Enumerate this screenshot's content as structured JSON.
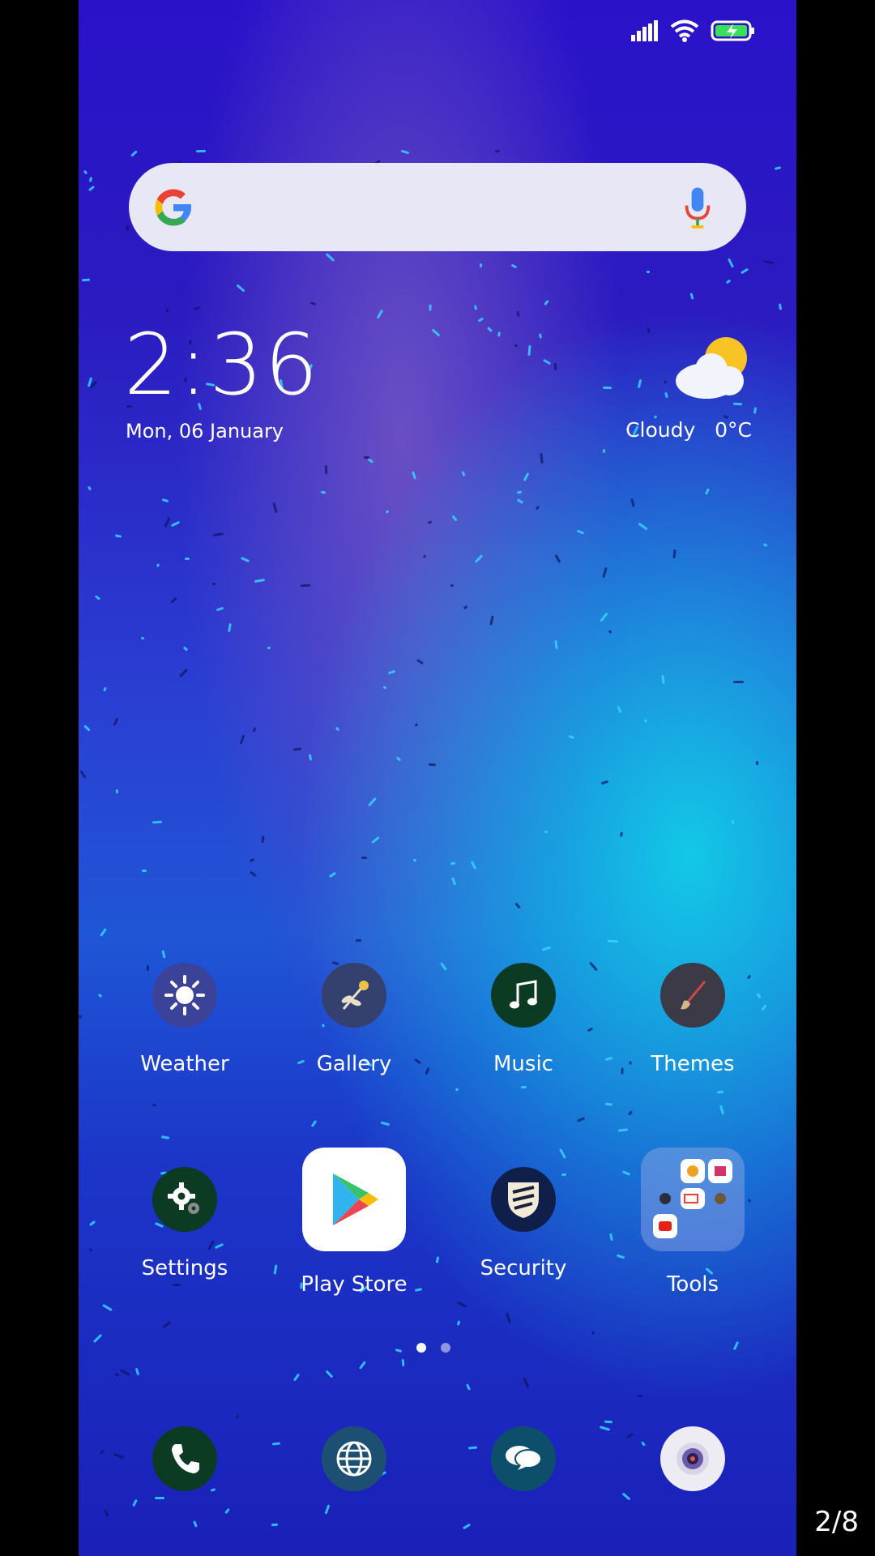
{
  "status": {
    "signal": "signal-icon",
    "wifi": "wifi-icon",
    "battery": "battery-charging-icon"
  },
  "search": {
    "logo": "google-g-icon",
    "mic": "mic-icon"
  },
  "clock": {
    "time": "2:36",
    "date": "Mon, 06 January"
  },
  "weather": {
    "condition": "Cloudy",
    "temperature": "0°C",
    "icon": "cloud-sun-icon"
  },
  "apps_row1": [
    {
      "label": "Weather",
      "icon": "sun-icon"
    },
    {
      "label": "Gallery",
      "icon": "flower-icon"
    },
    {
      "label": "Music",
      "icon": "music-note-icon"
    },
    {
      "label": "Themes",
      "icon": "brush-icon"
    }
  ],
  "apps_row2": [
    {
      "label": "Settings",
      "icon": "gear-icon"
    },
    {
      "label": "Play Store",
      "icon": "play-store-icon"
    },
    {
      "label": "Security",
      "icon": "shield-icon"
    },
    {
      "label": "Tools",
      "icon": "folder-icon"
    }
  ],
  "dock": [
    {
      "icon": "phone-icon"
    },
    {
      "icon": "globe-icon"
    },
    {
      "icon": "chat-bubble-icon"
    },
    {
      "icon": "camera-icon"
    }
  ],
  "pager": {
    "current": 1,
    "total": 2
  },
  "page_counter": "2/8",
  "colors": {
    "wallpaper_top": "#2a12c9",
    "wallpaper_cyan": "#13c8e6",
    "search_bg": "#e7e7f6"
  }
}
